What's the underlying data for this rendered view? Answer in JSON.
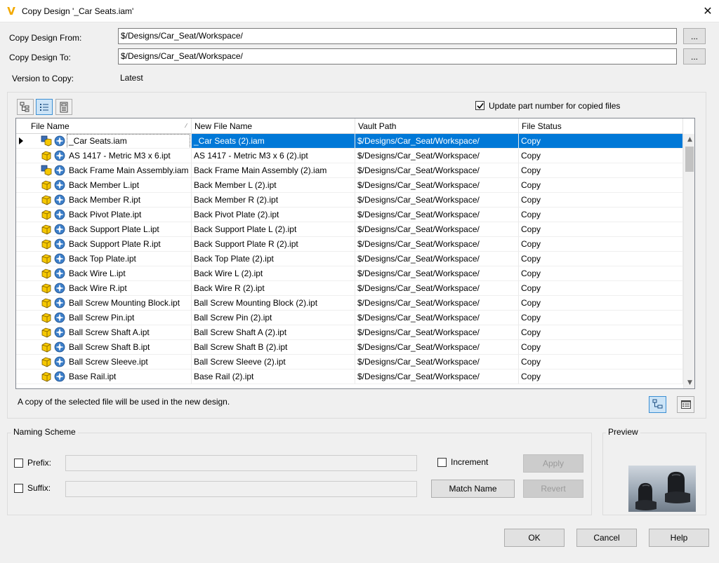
{
  "window": {
    "title": "Copy Design '_Car Seats.iam'"
  },
  "top": {
    "from_label": "Copy Design From:",
    "from_value": "$/Designs/Car_Seat/Workspace/",
    "to_label": "Copy Design To:",
    "to_value": "$/Designs/Car_Seat/Workspace/",
    "browse_label": "...",
    "version_label": "Version to Copy:",
    "version_value": "Latest"
  },
  "options": {
    "update_part_number_label": "Update part number for copied files",
    "update_part_number_checked": true
  },
  "grid": {
    "columns": [
      "File Name",
      "New File Name",
      "Vault Path",
      "File Status"
    ],
    "rows": [
      {
        "type": "assembly",
        "name": "_Car Seats.iam",
        "new_name": "_Car Seats (2).iam",
        "path": "$/Designs/Car_Seat/Workspace/",
        "status": "Copy"
      },
      {
        "type": "part",
        "name": "AS 1417 - Metric M3 x 6.ipt",
        "new_name": "AS 1417 - Metric M3 x 6 (2).ipt",
        "path": "$/Designs/Car_Seat/Workspace/",
        "status": "Copy"
      },
      {
        "type": "assembly",
        "name": "Back Frame Main Assembly.iam",
        "new_name": "Back Frame Main Assembly (2).iam",
        "path": "$/Designs/Car_Seat/Workspace/",
        "status": "Copy"
      },
      {
        "type": "part",
        "name": "Back Member L.ipt",
        "new_name": "Back Member L (2).ipt",
        "path": "$/Designs/Car_Seat/Workspace/",
        "status": "Copy"
      },
      {
        "type": "part",
        "name": "Back Member R.ipt",
        "new_name": "Back Member R (2).ipt",
        "path": "$/Designs/Car_Seat/Workspace/",
        "status": "Copy"
      },
      {
        "type": "part",
        "name": "Back Pivot Plate.ipt",
        "new_name": "Back Pivot Plate (2).ipt",
        "path": "$/Designs/Car_Seat/Workspace/",
        "status": "Copy"
      },
      {
        "type": "part",
        "name": "Back Support Plate L.ipt",
        "new_name": "Back Support Plate L (2).ipt",
        "path": "$/Designs/Car_Seat/Workspace/",
        "status": "Copy"
      },
      {
        "type": "part",
        "name": "Back Support Plate R.ipt",
        "new_name": "Back Support Plate R (2).ipt",
        "path": "$/Designs/Car_Seat/Workspace/",
        "status": "Copy"
      },
      {
        "type": "part",
        "name": "Back Top Plate.ipt",
        "new_name": "Back Top Plate (2).ipt",
        "path": "$/Designs/Car_Seat/Workspace/",
        "status": "Copy"
      },
      {
        "type": "part",
        "name": "Back Wire L.ipt",
        "new_name": "Back Wire L (2).ipt",
        "path": "$/Designs/Car_Seat/Workspace/",
        "status": "Copy"
      },
      {
        "type": "part",
        "name": "Back Wire R.ipt",
        "new_name": "Back Wire R (2).ipt",
        "path": "$/Designs/Car_Seat/Workspace/",
        "status": "Copy"
      },
      {
        "type": "part",
        "name": "Ball Screw Mounting Block.ipt",
        "new_name": "Ball Screw Mounting Block (2).ipt",
        "path": "$/Designs/Car_Seat/Workspace/",
        "status": "Copy"
      },
      {
        "type": "part",
        "name": "Ball Screw Pin.ipt",
        "new_name": "Ball Screw Pin (2).ipt",
        "path": "$/Designs/Car_Seat/Workspace/",
        "status": "Copy"
      },
      {
        "type": "part",
        "name": "Ball Screw Shaft A.ipt",
        "new_name": "Ball Screw Shaft A (2).ipt",
        "path": "$/Designs/Car_Seat/Workspace/",
        "status": "Copy"
      },
      {
        "type": "part",
        "name": "Ball Screw Shaft B.ipt",
        "new_name": "Ball Screw Shaft B (2).ipt",
        "path": "$/Designs/Car_Seat/Workspace/",
        "status": "Copy"
      },
      {
        "type": "part",
        "name": "Ball Screw Sleeve.ipt",
        "new_name": "Ball Screw Sleeve (2).ipt",
        "path": "$/Designs/Car_Seat/Workspace/",
        "status": "Copy"
      },
      {
        "type": "part",
        "name": "Base Rail.ipt",
        "new_name": "Base Rail (2).ipt",
        "path": "$/Designs/Car_Seat/Workspace/",
        "status": "Copy"
      }
    ]
  },
  "status_text": "A copy of the selected file will be used in the new design.",
  "naming": {
    "group_label": "Naming Scheme",
    "prefix_label": "Prefix:",
    "suffix_label": "Suffix:",
    "increment_label": "Increment",
    "apply_label": "Apply",
    "revert_label": "Revert",
    "match_name_label": "Match Name"
  },
  "preview": {
    "group_label": "Preview"
  },
  "footer": {
    "ok_label": "OK",
    "cancel_label": "Cancel",
    "help_label": "Help"
  },
  "colors": {
    "selection": "#0078d7",
    "accent": "#f2a900"
  }
}
